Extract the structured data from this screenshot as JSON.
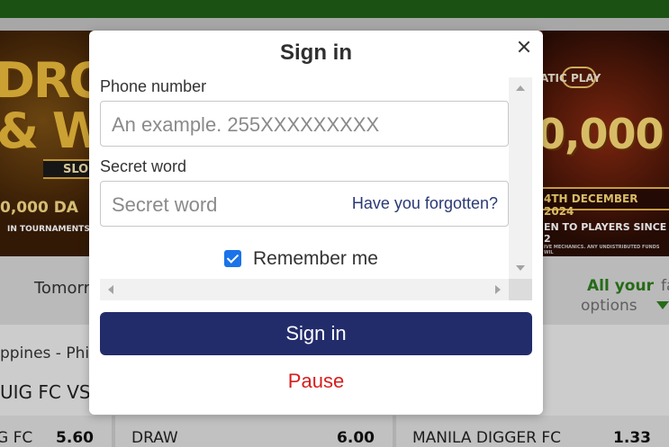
{
  "modal": {
    "title": "Sign in",
    "phone_label": "Phone number",
    "phone_placeholder": "An example. 255XXXXXXXXX",
    "secret_label": "Secret word",
    "secret_placeholder": "Secret word",
    "forgot_link": "Have you forgotten?",
    "remember_label": "Remember me",
    "remember_checked": true,
    "signin_button": "Sign in",
    "pause_link": "Pause"
  },
  "banner_left": {
    "line_a": "DRO",
    "line_b": "& W",
    "tag": "SLO",
    "amount": "0,000 DA",
    "sub": "IN TOURNAMENTS"
  },
  "banner_right": {
    "logo": "ATIC PLAY",
    "amount": "0,000",
    "date": "4TH DECEMBER 2024",
    "line": "EN TO PLAYERS SINCE 2",
    "fine_print": "IVE MECHANICS. ANY UNDISTRIBUTED FUNDS WIL"
  },
  "nav": {
    "tomorrow": "Tomorr",
    "all_your": "All your",
    "fav": "fa",
    "options": "options"
  },
  "league": "ppines - Phil",
  "match": "UIG FC VS M",
  "odds": [
    {
      "label": "G FC",
      "value": "5.60"
    },
    {
      "label": "DRAW",
      "value": "6.00"
    },
    {
      "label": "MANILA DIGGER FC",
      "value": "1.33"
    }
  ],
  "colors": {
    "topbar": "#1f5e17",
    "signin_button": "#232c6b",
    "pause_text": "#d71e1e",
    "forgot_text": "#2a3a75",
    "checkbox": "#1a73e8"
  }
}
